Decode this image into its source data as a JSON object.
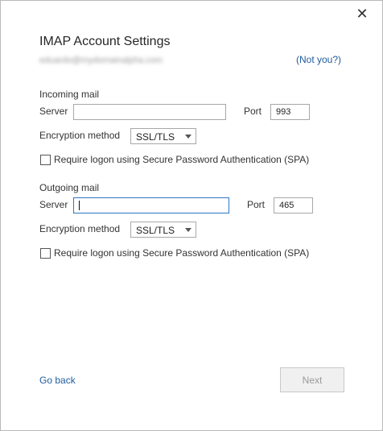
{
  "dialog": {
    "title": "IMAP Account Settings",
    "account_email": "eduardo@mydomainalpha.com",
    "not_you_link": "(Not you?)",
    "close_glyph": "✕"
  },
  "incoming": {
    "heading": "Incoming mail",
    "server_label": "Server",
    "server_value": "",
    "port_label": "Port",
    "port_value": "993",
    "encryption_label": "Encryption method",
    "encryption_value": "SSL/TLS",
    "spa_label": "Require logon using Secure Password Authentication (SPA)",
    "spa_checked": false
  },
  "outgoing": {
    "heading": "Outgoing mail",
    "server_label": "Server",
    "server_value": "",
    "port_label": "Port",
    "port_value": "465",
    "encryption_label": "Encryption method",
    "encryption_value": "SSL/TLS",
    "spa_label": "Require logon using Secure Password Authentication (SPA)",
    "spa_checked": false
  },
  "footer": {
    "go_back_label": "Go back",
    "next_label": "Next",
    "next_enabled": false
  },
  "colors": {
    "link": "#1f5c9e",
    "focus_border": "#2f77c4",
    "disabled_text": "#9a9a9a"
  }
}
